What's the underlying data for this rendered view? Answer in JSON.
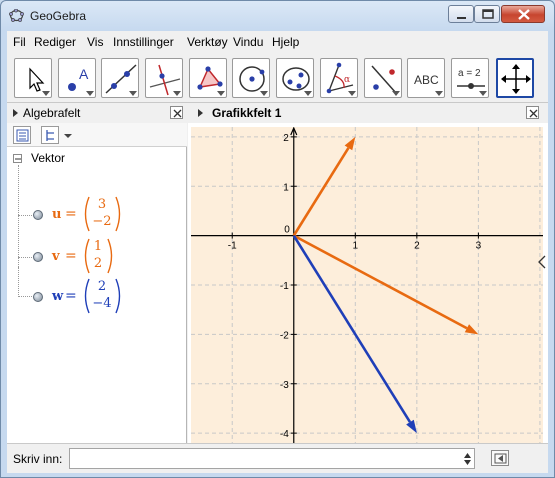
{
  "window": {
    "title": "GeoGebra"
  },
  "menu": [
    "Fil",
    "Rediger",
    "Vis",
    "Innstillinger",
    "Verktøy",
    "Vindu",
    "Hjelp"
  ],
  "toolbar": {
    "tools": [
      "move-tool",
      "point-tool",
      "line-tool",
      "perpendicular-line-tool",
      "polygon-tool",
      "circle-tool",
      "ellipse-tool",
      "angle-tool",
      "reflect-tool",
      "text-tool",
      "slider-tool",
      "move-graphics-view-tool"
    ],
    "text_tool_label": "ABC",
    "slider_tool_label": "a = 2"
  },
  "algebra": {
    "title": "Algebrafelt",
    "group": "Vektor",
    "vectors": [
      {
        "name": "u",
        "x": "3",
        "y": "−2",
        "color": "#e86a11"
      },
      {
        "name": "v",
        "x": "1",
        "y": "2",
        "color": "#e86a11"
      },
      {
        "name": "w",
        "x": "2",
        "y": "−4",
        "color": "#1f3fb8"
      }
    ]
  },
  "graphics": {
    "title": "Grafikkfelt 1",
    "origin_label": "0",
    "x_ticks": [
      "-1",
      "1",
      "2",
      "3"
    ],
    "y_ticks": [
      "2",
      "1",
      "-1",
      "-2",
      "-3",
      "-4"
    ]
  },
  "chart_data": {
    "type": "scatter",
    "series": [
      {
        "name": "u",
        "points": [
          [
            0,
            0
          ],
          [
            3,
            -2
          ]
        ],
        "color": "#e86a11"
      },
      {
        "name": "v",
        "points": [
          [
            0,
            0
          ],
          [
            1,
            2
          ]
        ],
        "color": "#e86a11"
      },
      {
        "name": "w",
        "points": [
          [
            0,
            0
          ],
          [
            2,
            -4
          ]
        ],
        "color": "#1f3fb8"
      }
    ],
    "xlim": [
      -1.67,
      4.05
    ],
    "ylim": [
      -4.2,
      2.2
    ],
    "grid": true,
    "background": "#fdeedb"
  },
  "input": {
    "label": "Skriv inn:",
    "value": "",
    "placeholder": ""
  }
}
